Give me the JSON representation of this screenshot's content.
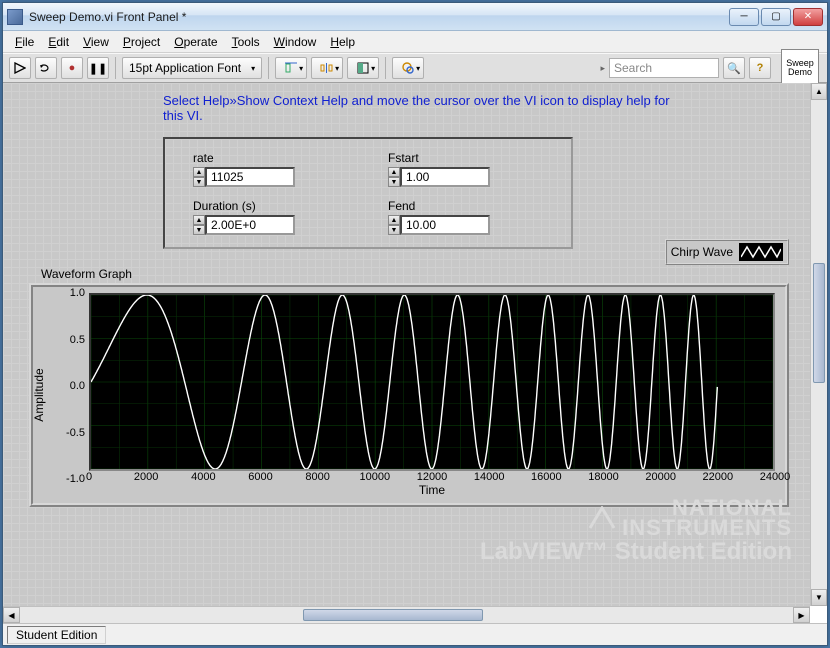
{
  "window": {
    "title": "Sweep Demo.vi Front Panel *",
    "vi_icon": "Sweep\nDemo"
  },
  "menu": [
    "File",
    "Edit",
    "View",
    "Project",
    "Operate",
    "Tools",
    "Window",
    "Help"
  ],
  "toolbar": {
    "run": "▷",
    "run_cont": "⟳",
    "abort": "●",
    "pause": "❚❚",
    "font": "15pt Application Font",
    "align": "▭",
    "dist": "▭▭",
    "resize": "◧",
    "reorder": "⚙",
    "search_placeholder": "Search",
    "search_icon": "🔍",
    "help": "?"
  },
  "help_text": "Select Help»Show Context Help and move the cursor over the VI icon to display help for this VI.",
  "controls": {
    "rate": {
      "label": "rate",
      "value": "11025"
    },
    "fstart": {
      "label": "Fstart",
      "value": "1.00"
    },
    "duration": {
      "label": "Duration (s)",
      "value": "2.00E+0"
    },
    "fend": {
      "label": "Fend",
      "value": "10.00"
    }
  },
  "graph": {
    "title": "Waveform Graph",
    "legend": "Chirp Wave",
    "ylabel": "Amplitude",
    "xlabel": "Time",
    "yticks": [
      "1.0",
      "0.5",
      "0.0",
      "-0.5",
      "-1.0"
    ],
    "xticks": [
      "0",
      "2000",
      "4000",
      "6000",
      "8000",
      "10000",
      "12000",
      "14000",
      "16000",
      "18000",
      "20000",
      "22000",
      "24000"
    ]
  },
  "status": {
    "edition": "Student Edition"
  },
  "watermark": {
    "line1": "NATIONAL",
    "line2": "INSTRUMENTS",
    "line3": "LabVIEW™ Student Edition"
  },
  "chart_data": {
    "type": "line",
    "title": "Waveform Graph",
    "xlabel": "Time",
    "ylabel": "Amplitude",
    "xlim": [
      0,
      24000
    ],
    "ylim": [
      -1.0,
      1.0
    ],
    "series": [
      {
        "name": "Chirp Wave",
        "function": "chirp",
        "params": {
          "fstart": 1.0,
          "fend": 10.0,
          "duration_s": 2.0,
          "sample_rate": 11025,
          "samples": 22050
        },
        "note": "y[n] = sin(2*pi*(fstart*t + (fend-fstart)/(2*duration)*t^2)), t=n/sample_rate, n=0..22049; amplitude sweeps 1→10 Hz over 2 s giving ~11 oscillations, plotted vs sample index 0–22050; region 22050..24000 blank"
      }
    ]
  }
}
